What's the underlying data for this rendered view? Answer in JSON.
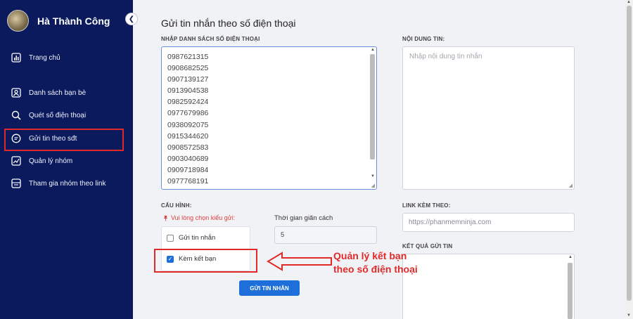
{
  "sidebar": {
    "user_name": "Hà Thành Công",
    "collapse_icon": "chevron-left-icon",
    "items": [
      {
        "label": "Trang chủ",
        "icon": "chart-bar-icon"
      },
      {
        "label": "Danh sách bạn bè",
        "icon": "user-icon"
      },
      {
        "label": "Quét số điện thoại",
        "icon": "search-icon"
      },
      {
        "label": "Gửi tin theo sđt",
        "icon": "chat-icon"
      },
      {
        "label": "Quản lý nhóm",
        "icon": "trend-icon"
      },
      {
        "label": "Tham gia nhóm theo link",
        "icon": "message-box-icon"
      }
    ],
    "highlight_color": "#e02a2a"
  },
  "main": {
    "title": "Gửi tin nhắn theo số điện thoại",
    "phone_list_label": "NHẬP DANH SÁCH SỐ ĐIỆN THOẠI",
    "phones": [
      "0987621315",
      "0908682525",
      "0907139127",
      "0913904538",
      "0982592424",
      "0977679986",
      "0938092075",
      "0915344620",
      "0908572583",
      "0903040689",
      "0909718984",
      "0977768191"
    ],
    "content_label": "NỘI DUNG TIN:",
    "content_placeholder": "Nhập nội dung tin nhắn",
    "config_label": "CẤU HÌNH:",
    "warning": "Vui lòng chọn kiểu gửi:",
    "options": [
      {
        "label": "Gửi tin nhắn",
        "checked": false
      },
      {
        "label": "Kèm kết bạn",
        "checked": true
      }
    ],
    "interval_label": "Thời gian giãn cách",
    "interval_value": "5",
    "send_button": "GỬI TIN NHẮN",
    "link_label": "LINK KÈM THEO:",
    "link_placeholder": "https://phanmemninja.com",
    "result_label": "KẾT QUẢ GỬI TIN",
    "accent_color": "#1e6fd9"
  },
  "annotation": {
    "line1": "Quản lý kết bạn",
    "line2": "theo số điện thoại"
  }
}
